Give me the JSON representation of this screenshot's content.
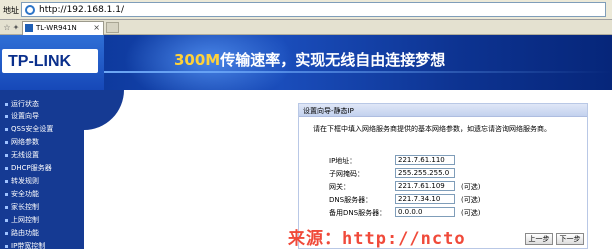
{
  "address_bar": {
    "label": "地址",
    "url": "http://192.168.1.1/"
  },
  "tab": {
    "title": "TL-WR941N",
    "close": "×"
  },
  "banner": {
    "logo": "TP-LINK",
    "slogan_highlight": "300M",
    "slogan_rest": "传输速率，实现无线自由连接梦想"
  },
  "sidebar": {
    "items": [
      {
        "label": "运行状态"
      },
      {
        "label": "设置向导"
      },
      {
        "label": "QSS安全设置"
      },
      {
        "label": "网络参数"
      },
      {
        "label": "无线设置"
      },
      {
        "label": "DHCP服务器"
      },
      {
        "label": "转发规则"
      },
      {
        "label": "安全功能"
      },
      {
        "label": "家长控制"
      },
      {
        "label": "上网控制"
      },
      {
        "label": "路由功能"
      },
      {
        "label": "IP带宽控制"
      }
    ]
  },
  "panel": {
    "title": "设置向导-静态IP",
    "intro": "请在下框中填入网络服务商提供的基本网络参数，如遗忘请咨询网络服务商。",
    "fields": [
      {
        "label": "IP地址：",
        "value": "221.7.61.110",
        "note": ""
      },
      {
        "label": "子网掩码：",
        "value": "255.255.255.0",
        "note": ""
      },
      {
        "label": "网关：",
        "value": "221.7.61.109",
        "note": "(可选)"
      },
      {
        "label": "DNS服务器：",
        "value": "221.7.34.10",
        "note": "(可选)"
      },
      {
        "label": "备用DNS服务器：",
        "value": "0.0.0.0",
        "note": "(可选)"
      }
    ],
    "buttons": {
      "back": "上一步",
      "next": "下一步"
    }
  },
  "watermark": "来源：http://ncto"
}
